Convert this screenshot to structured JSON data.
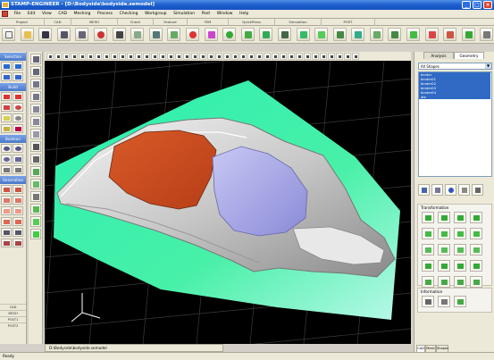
{
  "window": {
    "title": "STAMP-ENGINEER - [D:\\Bodyside\\bodyside.semodel]"
  },
  "menu": [
    "File",
    "Edit",
    "View",
    "CAD",
    "Meshing",
    "Process",
    "Checking",
    "Workgroup",
    "Simulation",
    "Post",
    "Window",
    "Help"
  ],
  "module_tabs": [
    "Project",
    "CAD",
    "MESH",
    "Check",
    "Feature",
    "FEM",
    "QuickPress",
    "Simulation",
    "POST"
  ],
  "left_panel": {
    "selection": "Selection",
    "build": "Build",
    "boolean": "Boolean",
    "generation": "Generation",
    "bottom_tabs": [
      "CAD",
      "MESH",
      "POST1",
      "POST2"
    ]
  },
  "doc_tab": "D:\\Bodyside\\bodyside.semodel",
  "right_panel": {
    "tabs": [
      "Analysis",
      "Geometry"
    ],
    "filter": "All Shapes",
    "list": [
      "binder",
      "binder01",
      "binder02",
      "binder03",
      "binder04",
      "die"
    ],
    "transformation": "Transformation",
    "information": "Information"
  },
  "statusbar": "Ready",
  "colors": {
    "binder": "#3ef0a8",
    "panel": "#d8d8d8",
    "red_face": "#c84a20",
    "blue_face": "#9c9ce0",
    "selection": "#316ac5"
  }
}
